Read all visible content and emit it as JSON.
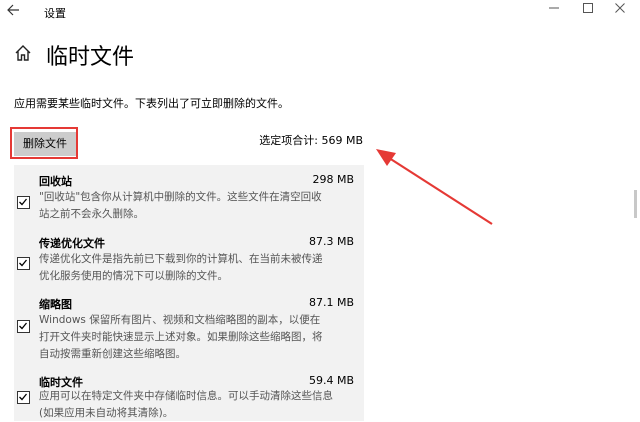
{
  "window": {
    "title": "设置",
    "minimize_icon": "minimize-icon",
    "maximize_icon": "maximize-icon",
    "close_icon": "close-icon"
  },
  "page": {
    "title": "临时文件",
    "description": "应用需要某些临时文件。下表列出了可立即删除的文件。",
    "delete_button": "删除文件",
    "total": "选定项合计: 569 MB"
  },
  "items": [
    {
      "name": "回收站",
      "size": "298 MB",
      "checked": true,
      "desc": [
        "\"回收站\"包含你从计算机中删除的文件。这些文件在清空回收",
        "站之前不会永久删除。"
      ]
    },
    {
      "name": "传递优化文件",
      "size": "87.3 MB",
      "checked": true,
      "desc": [
        "传递优化文件是指先前已下载到你的计算机、在当前未被传递",
        "优化服务使用的情况下可以删除的文件。"
      ]
    },
    {
      "name": "缩略图",
      "size": "87.1 MB",
      "checked": true,
      "desc": [
        "Windows 保留所有图片、视频和文档缩略图的副本，以便在",
        "打开文件夹时能快速显示上述对象。如果删除这些缩略图，将",
        "自动按需重新创建这些缩略图。"
      ]
    },
    {
      "name": "临时文件",
      "size": "59.4 MB",
      "checked": true,
      "desc": [
        "应用可以在特定文件夹中存储临时信息。可以手动清除这些信息",
        "(如果应用未自动将其清除)。"
      ]
    }
  ],
  "colors": {
    "highlight": "#e53935",
    "list_bg": "#f2f2f2",
    "button_bg": "#cccccc"
  }
}
